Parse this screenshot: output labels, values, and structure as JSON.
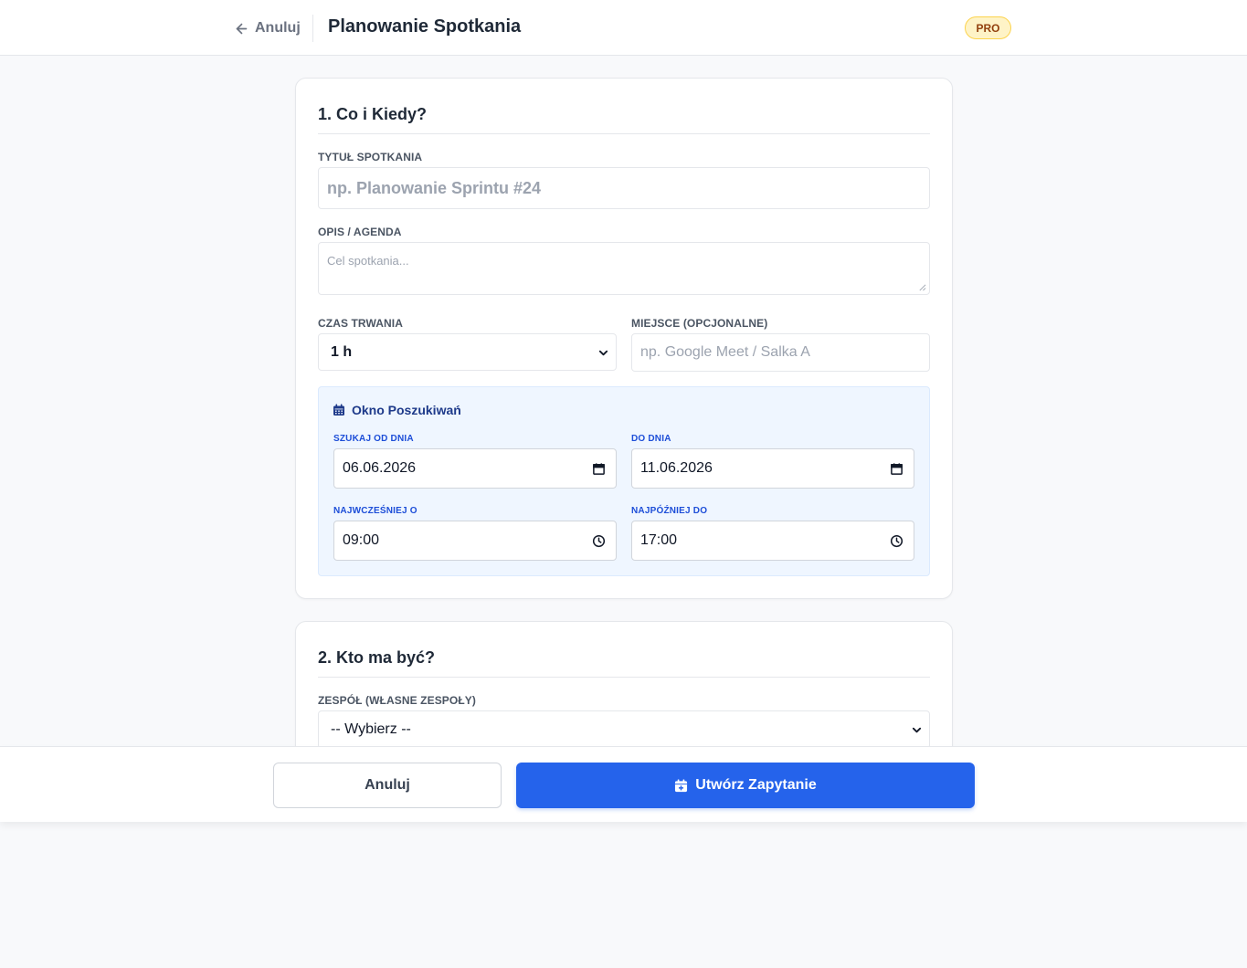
{
  "header": {
    "back_label": "Anuluj",
    "title": "Planowanie Spotkania",
    "badge": "PRO"
  },
  "section1": {
    "title": "1. Co i Kiedy?",
    "title_field": {
      "label": "TYTUŁ SPOTKANIA",
      "placeholder": "np. Planowanie Sprintu #24"
    },
    "description_field": {
      "label": "OPIS / AGENDA",
      "placeholder": "Cel spotkania..."
    },
    "duration_field": {
      "label": "CZAS TRWANIA",
      "value": "1 h"
    },
    "location_field": {
      "label": "MIEJSCE (OPCJONALNE)",
      "placeholder": "np. Google Meet / Salka A"
    },
    "search_window": {
      "title": "Okno Poszukiwań",
      "from_date": {
        "label": "SZUKAJ OD DNIA",
        "value": "06.06.2026"
      },
      "to_date": {
        "label": "DO DNIA",
        "value": "11.06.2026"
      },
      "earliest_time": {
        "label": "NAJWCZEŚNIEJ O",
        "value": "09:00"
      },
      "latest_time": {
        "label": "NAJPÓŹNIEJ DO",
        "value": "17:00"
      }
    }
  },
  "section2": {
    "title": "2. Kto ma być?",
    "team_field": {
      "label": "ZESPÓŁ (WŁASNE ZESPOŁY)",
      "value": "-- Wybierz --"
    }
  },
  "footer": {
    "cancel_label": "Anuluj",
    "submit_label": "Utwórz Zapytanie"
  },
  "colors": {
    "primary": "#2563eb",
    "badge_bg": "#fef3c7",
    "window_bg": "#eff6ff"
  }
}
